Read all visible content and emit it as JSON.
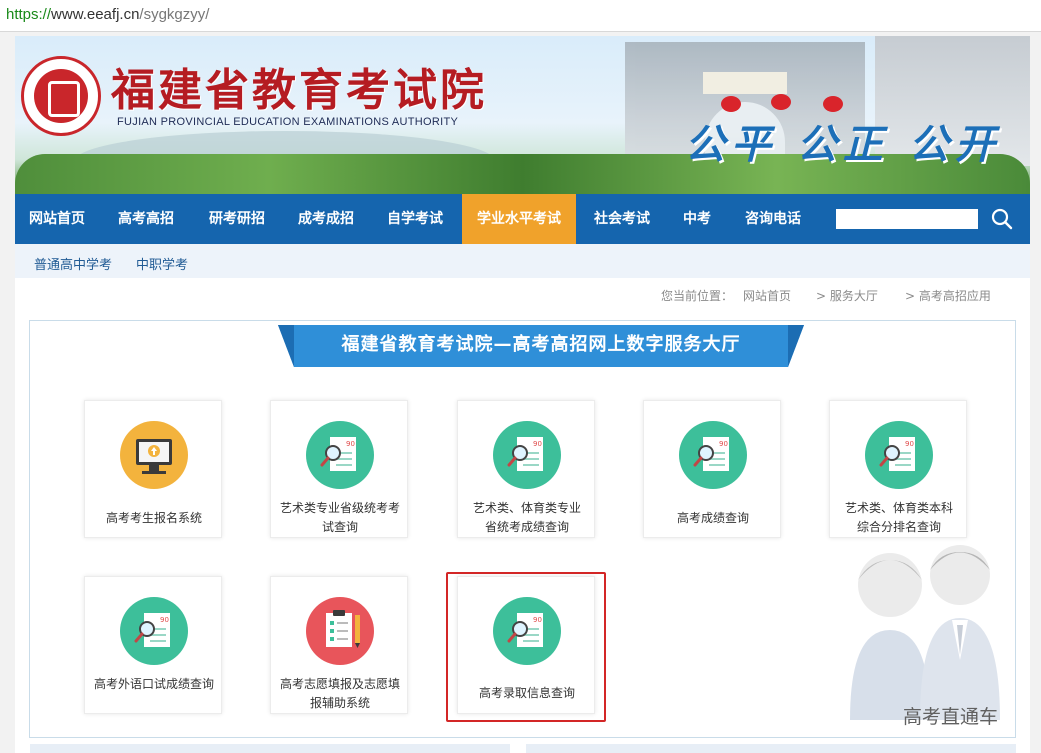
{
  "browser": {
    "url_protocol": "https://",
    "url_host": "www.eeafj.cn",
    "url_path": "/sygkgzyy/"
  },
  "header": {
    "title": "福建省教育考试院",
    "subtitle": "FUJIAN PROVINCIAL EDUCATION EXAMINATIONS AUTHORITY",
    "slogan": "公平 公正 公开"
  },
  "nav": {
    "items": [
      {
        "label": "网站首页"
      },
      {
        "label": "高考高招"
      },
      {
        "label": "研考研招"
      },
      {
        "label": "成考成招"
      },
      {
        "label": "自学考试"
      },
      {
        "label": "学业水平考试",
        "active": true
      },
      {
        "label": "社会考试"
      },
      {
        "label": "中考"
      },
      {
        "label": "咨询电话"
      }
    ],
    "search_placeholder": "",
    "search_icon": "search-icon",
    "active_color": "#f0a22b",
    "bar_color": "#1565ae"
  },
  "subnav": {
    "items": [
      {
        "label": "普通高中学考"
      },
      {
        "label": "中职学考"
      }
    ]
  },
  "breadcrumb": {
    "prefix": "您当前位置：",
    "items": [
      "网站首页",
      "> 服务大厅",
      "> 高考高招应用"
    ]
  },
  "hall": {
    "title": "福建省教育考试院—高考高招网上数字服务大厅",
    "cards": [
      {
        "line1": "高考考生报名系统",
        "line2": "",
        "icon": "computer-upload-icon",
        "color": "#f3b33d"
      },
      {
        "line1": "艺术类专业省级统考考",
        "line2": "试查询",
        "icon": "magnifier-document-icon",
        "color": "#3dbf9a"
      },
      {
        "line1": "艺术类、体育类专业",
        "line2": "省统考成绩查询",
        "icon": "magnifier-document-icon",
        "color": "#3dbf9a"
      },
      {
        "line1": "高考成绩查询",
        "line2": "",
        "icon": "magnifier-document-icon",
        "color": "#3dbf9a"
      },
      {
        "line1": "艺术类、体育类本科",
        "line2": "综合分排名查询",
        "icon": "magnifier-document-icon",
        "color": "#3dbf9a"
      },
      {
        "line1": "高考外语口试成绩查询",
        "line2": "",
        "icon": "magnifier-document-icon",
        "color": "#3dbf9a"
      },
      {
        "line1": "高考志愿填报及志愿填",
        "line2": "报辅助系统",
        "icon": "checklist-pencil-icon",
        "color": "#e8555b"
      },
      {
        "line1": "高考录取信息查询",
        "line2": "",
        "icon": "magnifier-document-icon",
        "color": "#3dbf9a"
      }
    ]
  },
  "watermark": "高考直通车"
}
